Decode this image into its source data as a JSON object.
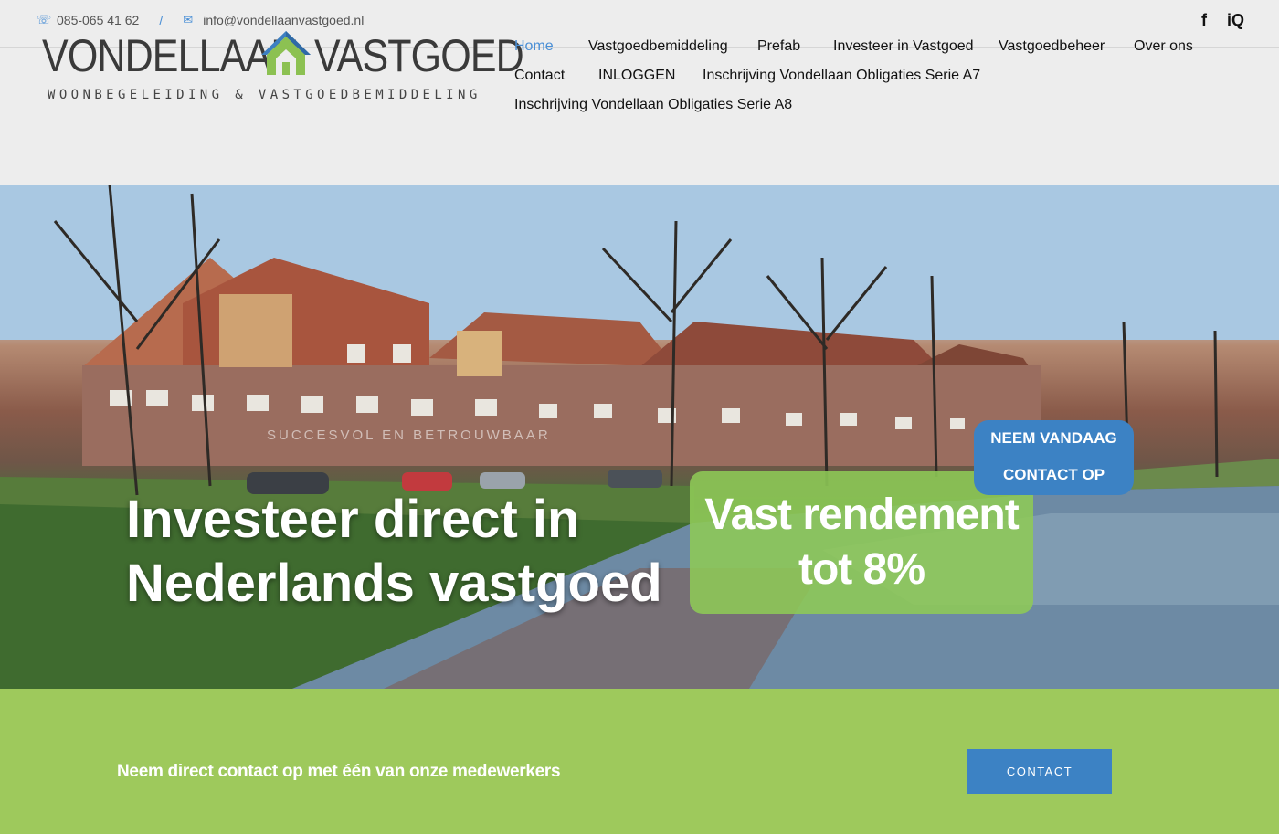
{
  "topbar": {
    "phone": "085-065 41 62",
    "separator": "/",
    "email": "info@vondellaanvastgoed.nl",
    "phone_icon": "phone-icon",
    "mail_icon": "mail-icon",
    "social": {
      "facebook_label": "f",
      "search_label": "iQ"
    }
  },
  "logo": {
    "word1": "VONDELLAAN",
    "word2": "VASTGOED",
    "tagline": "WOONBEGELEIDING & VASTGOEDBEMIDDELING"
  },
  "nav": {
    "items": [
      {
        "label": "Home",
        "active": true
      },
      {
        "label": "Vastgoedbemiddeling"
      },
      {
        "label": "Prefab"
      },
      {
        "label": "Investeer in Vastgoed"
      },
      {
        "label": "Vastgoedbeheer"
      },
      {
        "label": "Over ons"
      },
      {
        "label": "Contact"
      },
      {
        "label": "INLOGGEN"
      },
      {
        "label": "Inschrijving Vondellaan Obligaties Serie A7"
      },
      {
        "label": "Inschrijving Vondellaan Obligaties Serie A8"
      }
    ]
  },
  "hero": {
    "overline": "SUCCESVOL EN BETROUWBAAR",
    "headline_line1": "Investeer direct in",
    "headline_line2": "Nederlands vastgoed",
    "promo_line1": "Vast rendement",
    "promo_line2": "tot 8%",
    "cta_line1": "NEEM VANDAAG",
    "cta_line2": "CONTACT OP"
  },
  "band": {
    "message": "Neem direct contact op met één van onze medewerkers",
    "button": "CONTACT"
  },
  "colors": {
    "accent_blue": "#3c82c4",
    "brand_green": "#9ec95c",
    "nav_active": "#4a8fd6"
  }
}
